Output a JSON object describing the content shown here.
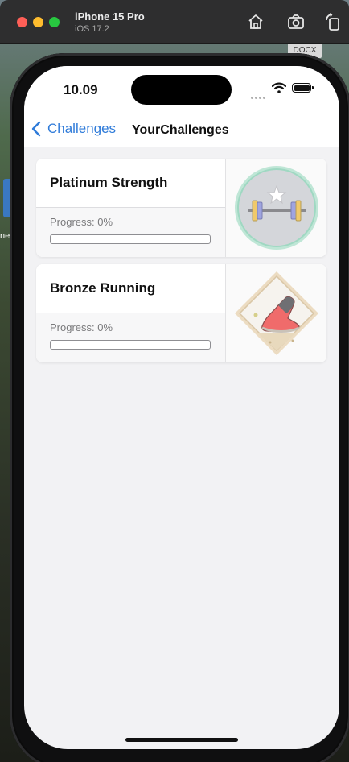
{
  "window": {
    "title": "iPhone 15 Pro",
    "subtitle": "iOS 17.2"
  },
  "desktop": {
    "file_label": "DOCX",
    "left_label": "ne"
  },
  "status_bar": {
    "time": "10.09"
  },
  "nav": {
    "back_label": "Challenges",
    "title": "YourChallenges"
  },
  "challenges": [
    {
      "title": "Platinum Strength",
      "progress_label": "Progress: 0%",
      "progress": 0,
      "badge_icon": "dumbbell-star-badge-icon"
    },
    {
      "title": "Bronze Running",
      "progress_label": "Progress: 0%",
      "progress": 0,
      "badge_icon": "running-shoe-badge-icon"
    }
  ],
  "colors": {
    "accent": "#2f7bd9",
    "background": "#f2f2f4"
  }
}
